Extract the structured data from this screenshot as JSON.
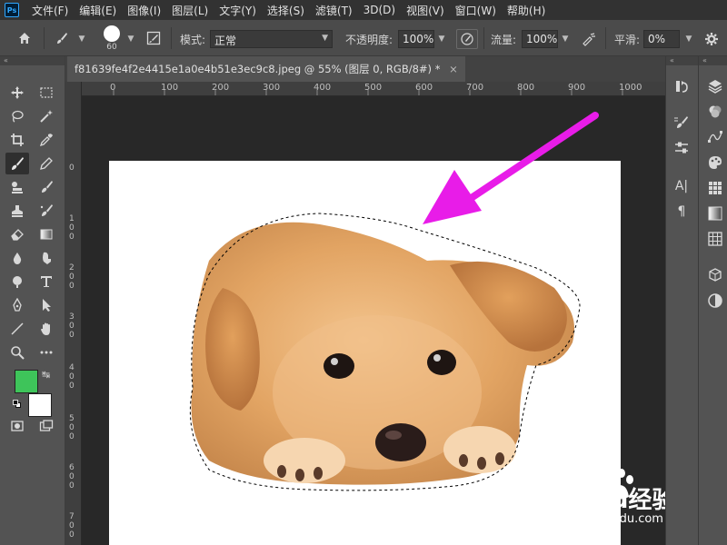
{
  "app": {
    "logo": "Ps"
  },
  "menu": [
    "文件(F)",
    "编辑(E)",
    "图像(I)",
    "图层(L)",
    "文字(Y)",
    "选择(S)",
    "滤镜(T)",
    "3D(D)",
    "视图(V)",
    "窗口(W)",
    "帮助(H)"
  ],
  "options": {
    "brush_size": "60",
    "mode_label": "模式:",
    "mode_value": "正常",
    "opacity_label": "不透明度:",
    "opacity_value": "100%",
    "flow_label": "流量:",
    "flow_value": "100%",
    "smoothing_label": "平滑:",
    "smoothing_value": "0%"
  },
  "document": {
    "tab_title": "f81639fe4f2e4415e1a0e4b51e3ec9c8.jpeg @ 55% (图层 0, RGB/8#) *",
    "close_glyph": "×"
  },
  "rulers": {
    "top_ticks": [
      "0",
      "100",
      "200",
      "300",
      "400",
      "500",
      "600",
      "700",
      "800",
      "900",
      "1000"
    ],
    "left_ticks": [
      "0",
      "1 0 0",
      "2 0 0",
      "3 0 0",
      "4 0 0",
      "5 0 0",
      "6 0 0",
      "7 0 0"
    ]
  },
  "right_panel": {
    "type_tool_label": "A|",
    "paragraph_label": "¶"
  },
  "watermark": {
    "brand": "Baidu经验",
    "url": "jingyan.baidu.com"
  },
  "colors": {
    "foreground": "#3ec45a",
    "background": "#ffffff",
    "arrow": "#e81ce8",
    "canvas_bg": "#282828"
  }
}
